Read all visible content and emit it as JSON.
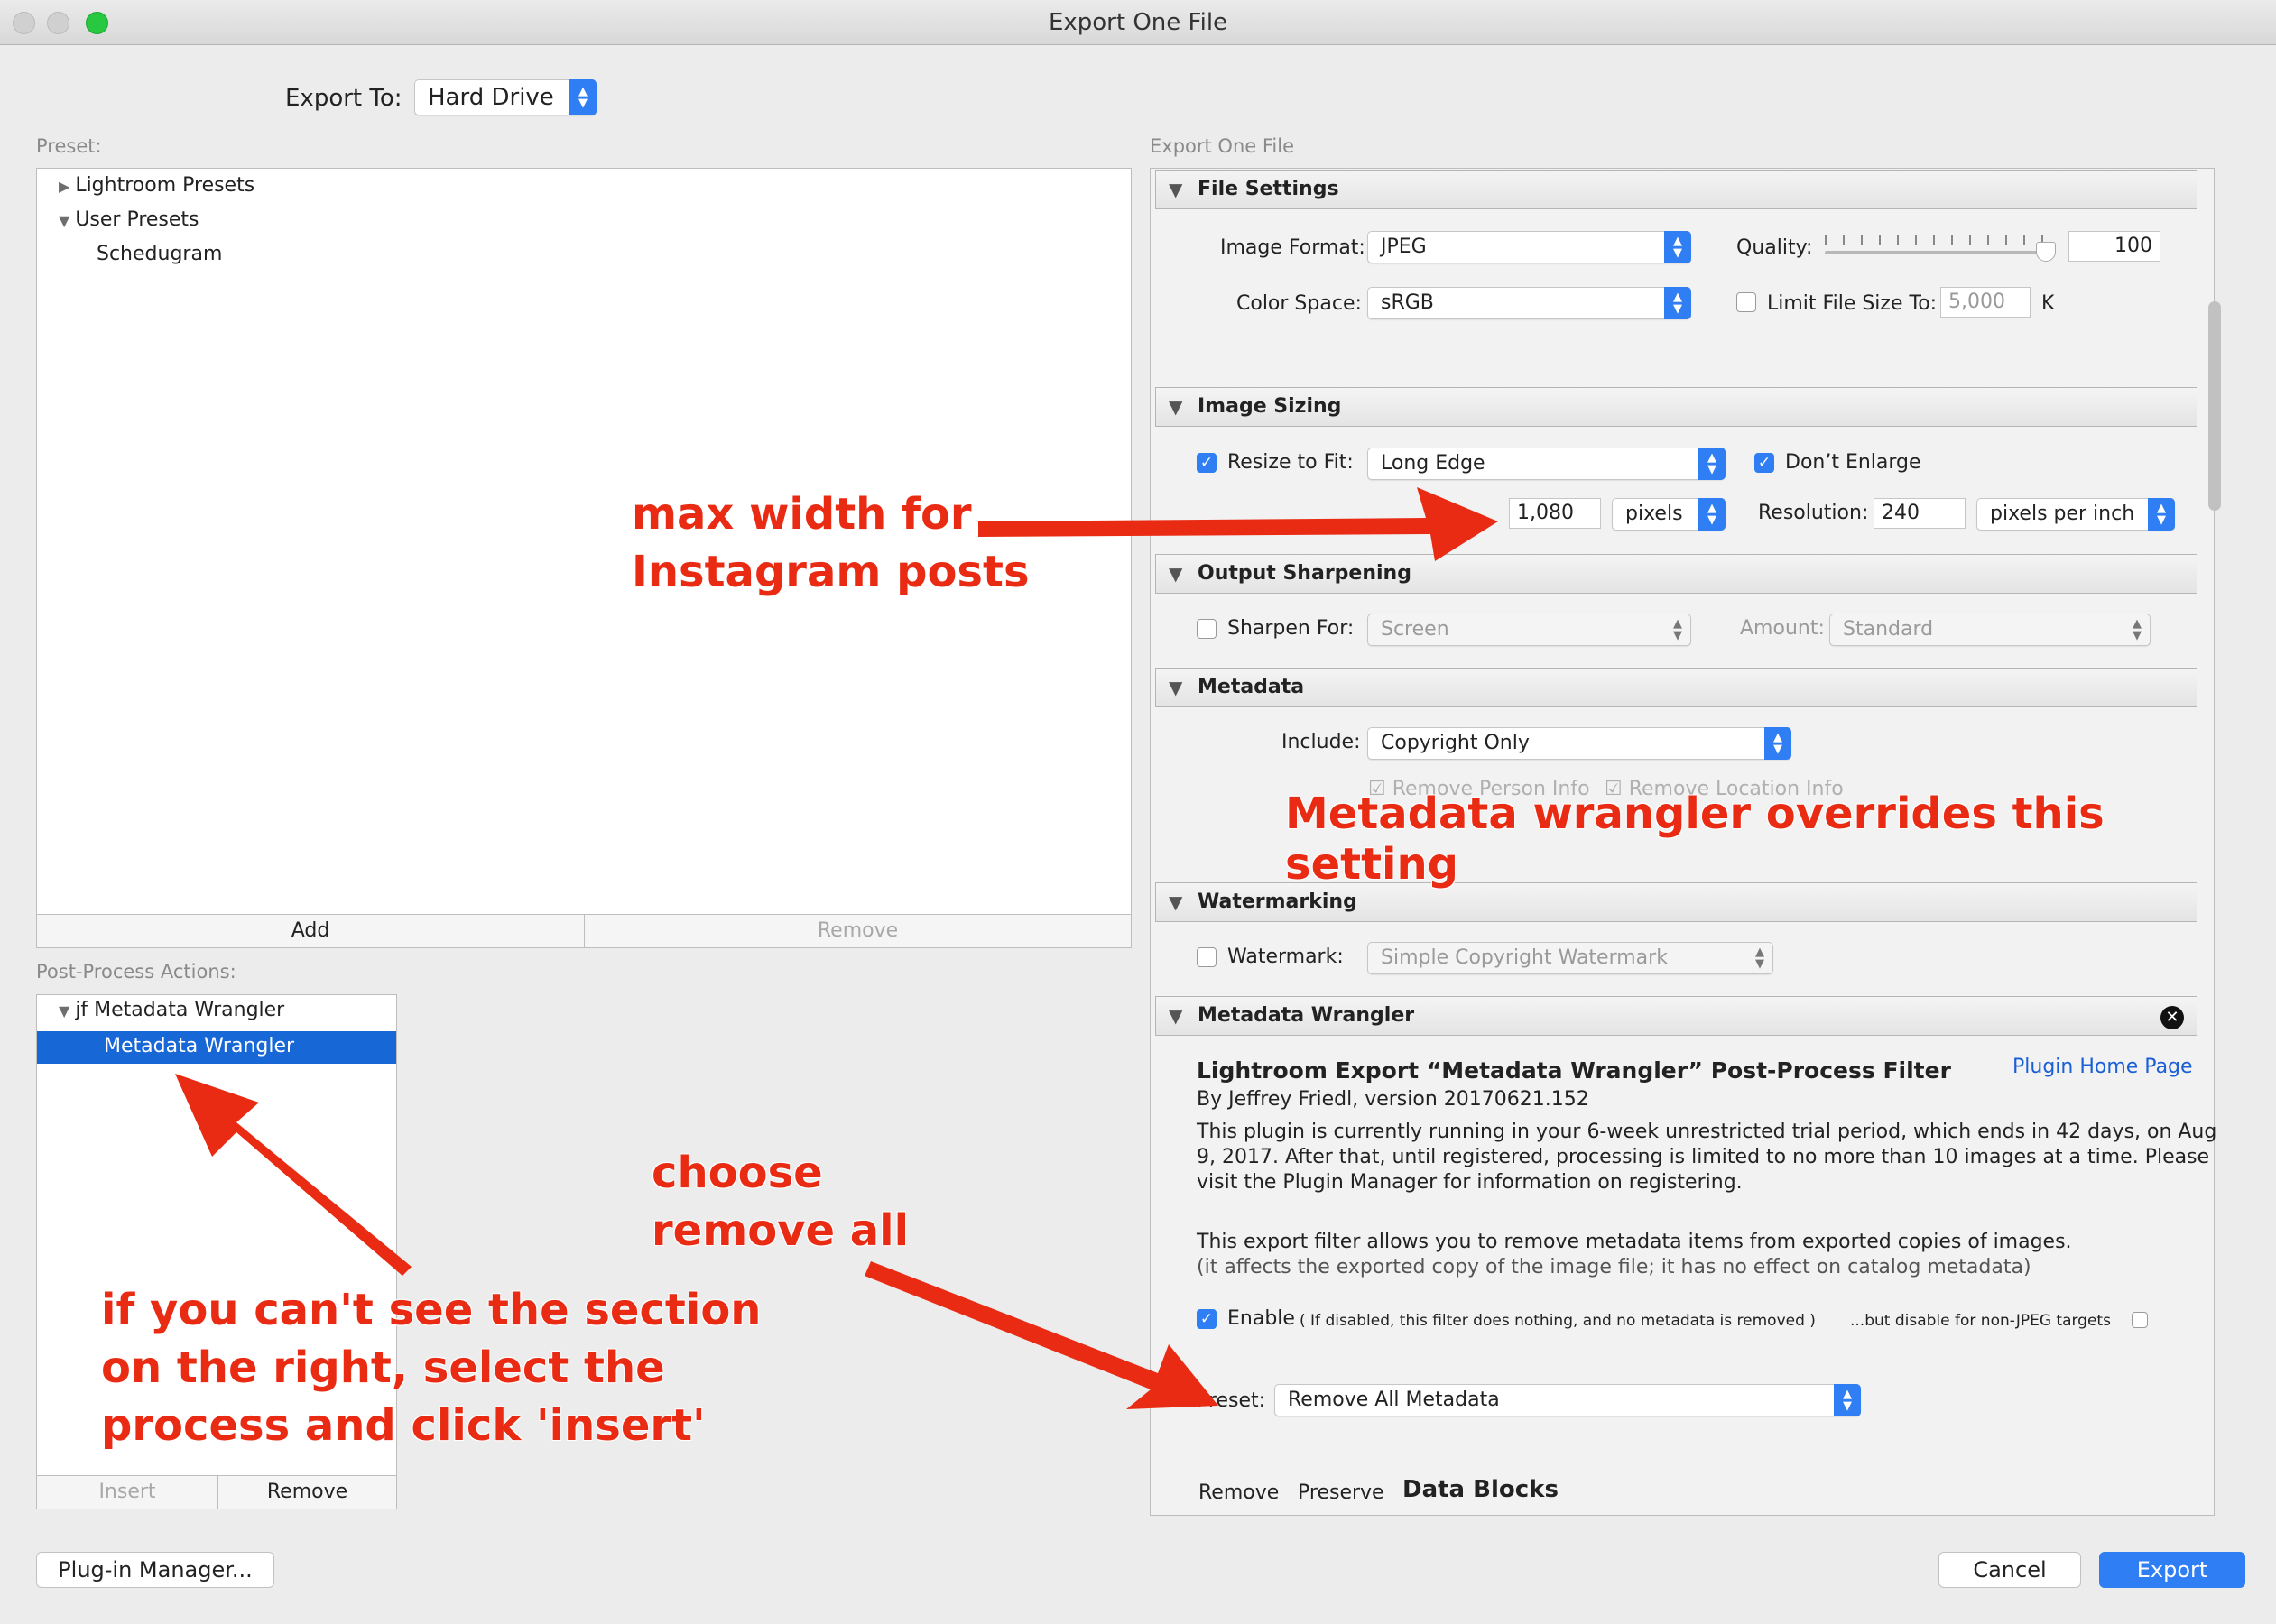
{
  "window": {
    "title": "Export One File"
  },
  "export_to": {
    "label": "Export To:",
    "value": "Hard Drive"
  },
  "preset_panel": {
    "label": "Preset:",
    "items": [
      "Lightroom Presets",
      "User Presets",
      "Schedugram"
    ],
    "add": "Add",
    "remove": "Remove"
  },
  "post_process": {
    "label": "Post-Process Actions:",
    "group": "jf Metadata Wrangler",
    "selected": "Metadata Wrangler",
    "insert": "Insert",
    "remove": "Remove"
  },
  "right_label": "Export One File",
  "file_settings": {
    "title": "File Settings",
    "image_format_label": "Image Format:",
    "image_format": "JPEG",
    "quality_label": "Quality:",
    "quality": "100",
    "color_space_label": "Color Space:",
    "color_space": "sRGB",
    "limit_label": "Limit File Size To:",
    "limit_value": "5,000",
    "limit_unit": "K"
  },
  "image_sizing": {
    "title": "Image Sizing",
    "resize_label": "Resize to Fit:",
    "resize_value": "Long Edge",
    "dont_enlarge": "Don’t Enlarge",
    "size": "1,080",
    "size_unit": "pixels",
    "resolution_label": "Resolution:",
    "resolution": "240",
    "resolution_unit": "pixels per inch"
  },
  "output_sharpening": {
    "title": "Output Sharpening",
    "sharpen_label": "Sharpen For:",
    "sharpen_value": "Screen",
    "amount_label": "Amount:",
    "amount_value": "Standard"
  },
  "metadata": {
    "title": "Metadata",
    "include_label": "Include:",
    "include_value": "Copyright Only",
    "remove_person": "Remove Person Info",
    "remove_location": "Remove Location Info"
  },
  "watermarking": {
    "title": "Watermarking",
    "label": "Watermark:",
    "value": "Simple Copyright Watermark"
  },
  "wrangler": {
    "title": "Metadata Wrangler",
    "heading": "Lightroom Export “Metadata Wrangler” Post-Process Filter",
    "home_link": "Plugin Home Page",
    "byline": "By Jeffrey Friedl, version 20170621.152",
    "trial_line1": "This plugin is currently running in your 6-week unrestricted trial period, which ends in 42 days, on Aug",
    "trial_line2": "9, 2017. After that, until registered, processing is limited to no more than 10 images at a time. Please",
    "trial_line3": "visit the Plugin Manager for information on registering.",
    "desc_line1": "This export filter allows you to remove metadata items from exported copies of images.",
    "desc_line2": "(it affects the exported copy of the image file; it has no effect on catalog metadata)",
    "enable": "Enable",
    "enable_note": "( If disabled, this filter does nothing, and no metadata is removed )",
    "jpeg_note": "...but disable for non-JPEG targets",
    "preset_label": "Preset:",
    "preset_value": "Remove All Metadata",
    "col_remove": "Remove",
    "col_preserve": "Preserve",
    "col_blocks": "Data Blocks"
  },
  "bottom": {
    "plugin_manager": "Plug-in Manager...",
    "cancel": "Cancel",
    "export": "Export"
  },
  "annotations": {
    "max_width_line1": "max width for",
    "max_width_line2": "Instagram posts",
    "overrides": "Metadata wrangler overrides this setting",
    "choose_line1": "choose",
    "choose_line2": "remove all",
    "insert_line1": "if you can't see the section",
    "insert_line2": "on the right, select the",
    "insert_line3": "process and click 'insert'"
  },
  "colors": {
    "accent": "#2f7ef3",
    "selection": "#1767d6",
    "annotation": "#ea2b13"
  }
}
